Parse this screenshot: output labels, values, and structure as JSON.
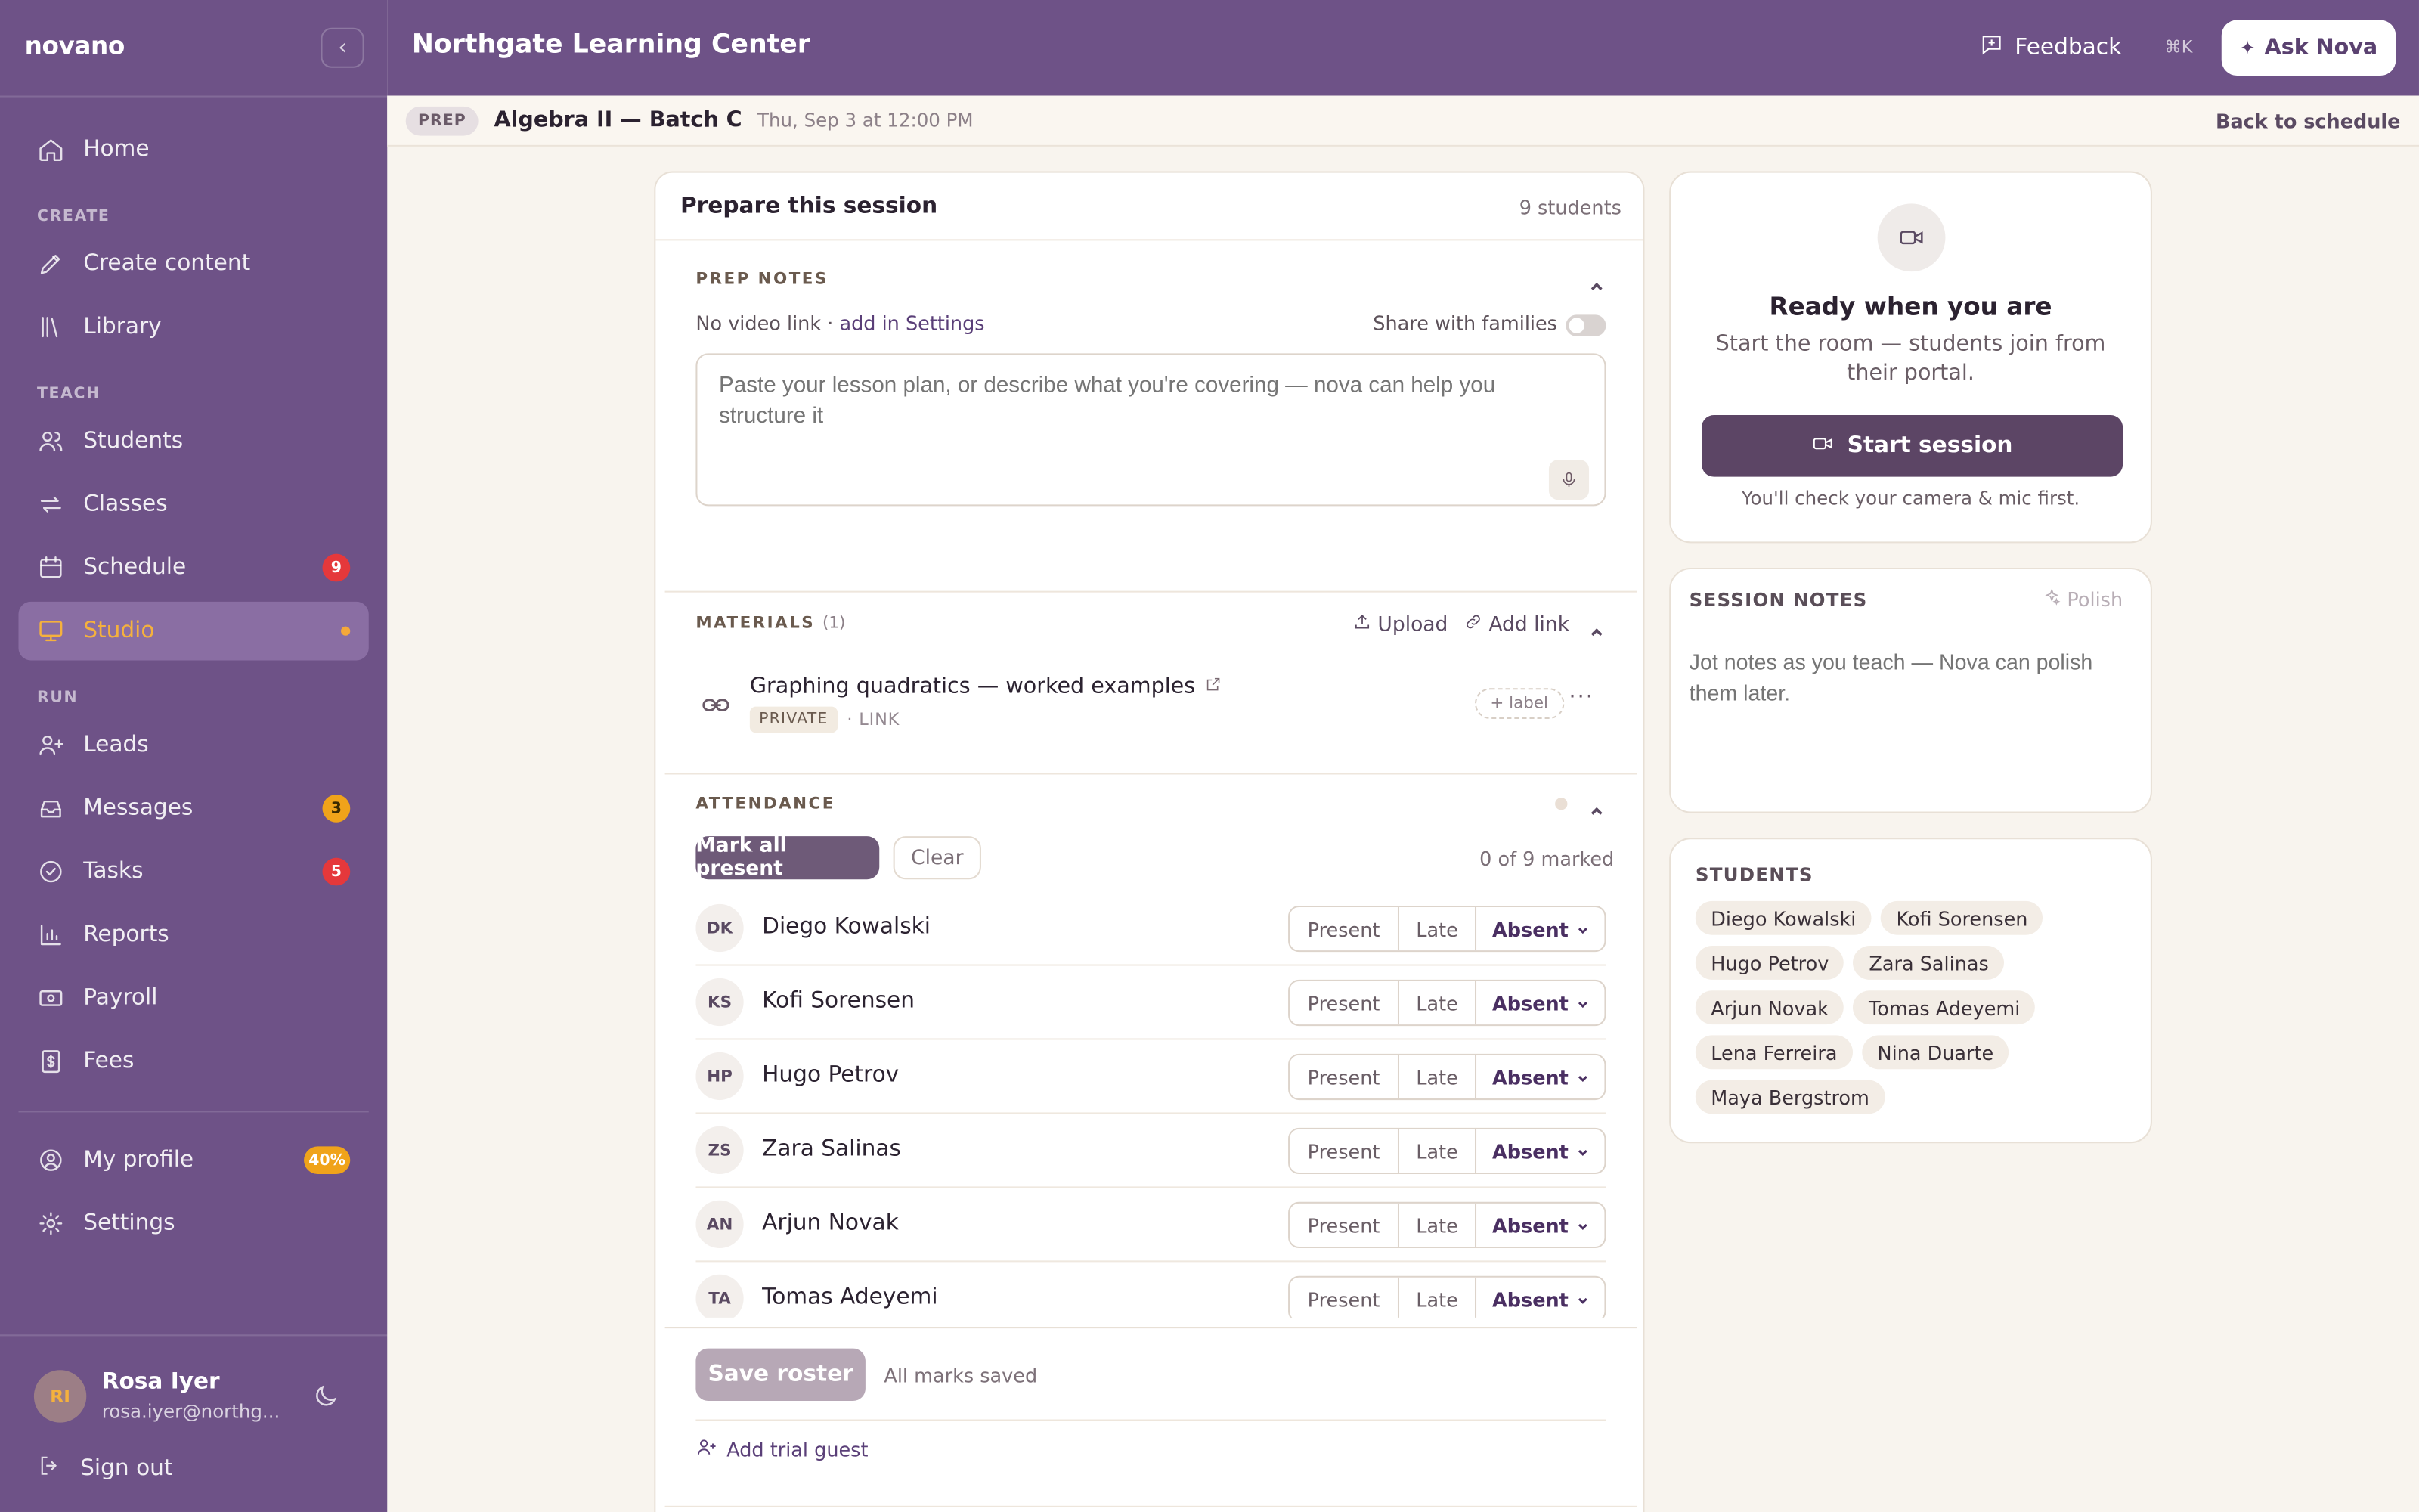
{
  "sidebar": {
    "brand": "novano",
    "sections": {
      "create": "CREATE",
      "teach": "TEACH",
      "run": "RUN"
    },
    "items": {
      "home": "Home",
      "create_content": "Create content",
      "library": "Library",
      "students": "Students",
      "classes": "Classes",
      "schedule": "Schedule",
      "studio": "Studio",
      "leads": "Leads",
      "messages": "Messages",
      "tasks": "Tasks",
      "reports": "Reports",
      "payroll": "Payroll",
      "fees": "Fees",
      "my_profile": "My profile",
      "settings": "Settings"
    },
    "badges": {
      "schedule": "9",
      "messages": "3",
      "tasks": "5",
      "my_profile": "40%"
    },
    "user": {
      "initials": "RI",
      "name": "Rosa Iyer",
      "email": "rosa.iyer@northg..."
    },
    "sign_out": "Sign out"
  },
  "topbar": {
    "title": "Northgate Learning Center",
    "feedback": "Feedback",
    "shortcut": "⌘K",
    "ask_nova": "Ask Nova"
  },
  "subbar": {
    "chip": "PREP",
    "title": "Algebra II — Batch C",
    "date": "Thu, Sep 3 at 12:00 PM",
    "back": "Back to schedule"
  },
  "prepare": {
    "title": "Prepare this session",
    "count": "9 students",
    "prep_notes": {
      "label": "PREP NOTES",
      "no_video": "No video link · ",
      "add_settings": "add in Settings",
      "share": "Share with families",
      "placeholder": "Paste your lesson plan, or describe what you're covering — nova can help you structure it"
    },
    "materials": {
      "label": "MATERIALS",
      "count": "(1)",
      "upload": "Upload",
      "add_link": "Add link",
      "item_title": "Graphing quadratics — worked examples",
      "item_visibility": "PRIVATE",
      "item_type": "· LINK",
      "add_label": "+ label"
    },
    "attendance": {
      "label": "ATTENDANCE",
      "mark_all": "Mark all present",
      "clear": "Clear",
      "marked": "0 of 9 marked",
      "options": {
        "present": "Present",
        "late": "Late",
        "absent": "Absent"
      },
      "rows": [
        {
          "initials": "DK",
          "name": "Diego Kowalski"
        },
        {
          "initials": "KS",
          "name": "Kofi Sorensen"
        },
        {
          "initials": "HP",
          "name": "Hugo Petrov"
        },
        {
          "initials": "ZS",
          "name": "Zara Salinas"
        },
        {
          "initials": "AN",
          "name": "Arjun Novak"
        },
        {
          "initials": "TA",
          "name": "Tomas Adeyemi"
        }
      ],
      "save": "Save roster",
      "saved_note": "All marks saved",
      "trial": "Add trial guest"
    }
  },
  "ready": {
    "title": "Ready when you are",
    "subtitle": "Start the room — students join from their portal.",
    "start": "Start session",
    "check": "You'll check your camera & mic first."
  },
  "session_notes": {
    "label": "SESSION NOTES",
    "polish": "Polish",
    "placeholder": "Jot notes as you teach — Nova can polish them later."
  },
  "students": {
    "label": "STUDENTS",
    "names": [
      "Diego Kowalski",
      "Kofi Sorensen",
      "Hugo Petrov",
      "Zara Salinas",
      "Arjun Novak",
      "Tomas Adeyemi",
      "Lena Ferreira",
      "Nina Duarte",
      "Maya Bergstrom"
    ]
  }
}
